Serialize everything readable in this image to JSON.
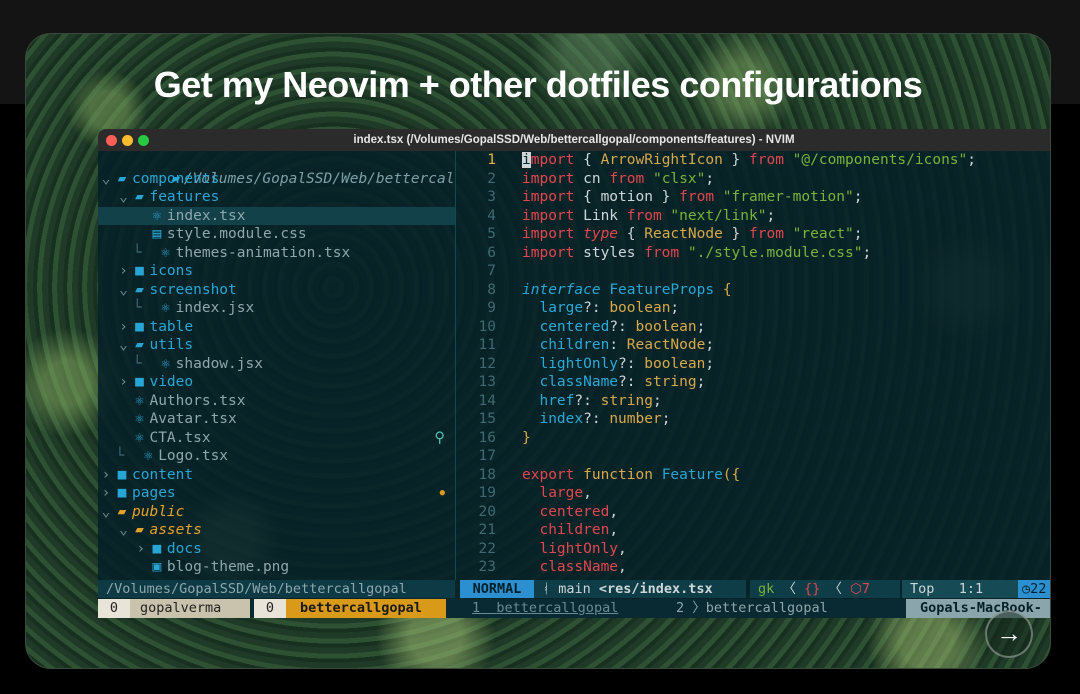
{
  "colors": {
    "accent_red": "#e0464e",
    "accent_green": "#79b33a",
    "accent_blue": "#27a6d6",
    "accent_yellow": "#d7a84a",
    "bg_terminal": "#062028"
  },
  "headline": "Get my Neovim + other dotfiles configurations",
  "window": {
    "title": "index.tsx (/Volumes/GopalSSD/Web/bettercallgopal/components/features) - NVIM"
  },
  "tree": {
    "root": "/Volumes/GopalSSD/Web/bettercallgopal",
    "items": [
      {
        "indent": "",
        "arrow": "⌄",
        "icon": "folder-open-icon",
        "label": "components",
        "color": "#27a6d6"
      },
      {
        "indent": "  ",
        "arrow": "⌄",
        "icon": "folder-open-icon",
        "label": "features",
        "color": "#27a6d6"
      },
      {
        "indent": "    ",
        "arrow": "",
        "icon": "react-icon",
        "label": "index.tsx",
        "color": "#8fa6ad",
        "selected": true
      },
      {
        "indent": "    ",
        "arrow": "",
        "icon": "css-icon",
        "label": "style.module.css",
        "color": "#8fa6ad"
      },
      {
        "indent": "    └",
        "arrow": "",
        "icon": "react-icon",
        "label": "themes-animation.tsx",
        "color": "#8fa6ad"
      },
      {
        "indent": "  ",
        "arrow": "›",
        "icon": "folder-icon",
        "label": "icons",
        "color": "#27a6d6"
      },
      {
        "indent": "  ",
        "arrow": "⌄",
        "icon": "folder-open-icon",
        "label": "screenshot",
        "color": "#27a6d6"
      },
      {
        "indent": "    └",
        "arrow": "",
        "icon": "react-icon",
        "label": "index.jsx",
        "color": "#8fa6ad"
      },
      {
        "indent": "  ",
        "arrow": "›",
        "icon": "folder-icon",
        "label": "table",
        "color": "#27a6d6"
      },
      {
        "indent": "  ",
        "arrow": "⌄",
        "icon": "folder-open-icon",
        "label": "utils",
        "color": "#27a6d6"
      },
      {
        "indent": "    └",
        "arrow": "",
        "icon": "react-icon",
        "label": "shadow.jsx",
        "color": "#8fa6ad"
      },
      {
        "indent": "  ",
        "arrow": "›",
        "icon": "folder-icon",
        "label": "video",
        "color": "#27a6d6"
      },
      {
        "indent": "  ",
        "arrow": "",
        "icon": "react-icon",
        "label": "Authors.tsx",
        "color": "#8fa6ad"
      },
      {
        "indent": "  ",
        "arrow": "",
        "icon": "react-icon",
        "label": "Avatar.tsx",
        "color": "#8fa6ad"
      },
      {
        "indent": "  ",
        "arrow": "",
        "icon": "react-icon",
        "label": "CTA.tsx",
        "color": "#8fa6ad",
        "badge": "bulb-icon"
      },
      {
        "indent": "  └",
        "arrow": "",
        "icon": "react-icon",
        "label": "Logo.tsx",
        "color": "#8fa6ad"
      },
      {
        "indent": "",
        "arrow": "›",
        "icon": "folder-icon",
        "label": "content",
        "color": "#27a6d6"
      },
      {
        "indent": "",
        "arrow": "›",
        "icon": "folder-icon",
        "label": "pages",
        "color": "#27a6d6",
        "badge": "modified-dot"
      },
      {
        "indent": "",
        "arrow": "⌄",
        "icon": "folder-open-icon",
        "label": "public",
        "color": "#e5a12b",
        "italic": true
      },
      {
        "indent": "  ",
        "arrow": "⌄",
        "icon": "folder-open-icon",
        "label": "assets",
        "color": "#e5a12b",
        "italic": true
      },
      {
        "indent": "    ",
        "arrow": "›",
        "icon": "folder-icon",
        "label": "docs",
        "color": "#27a6d6"
      },
      {
        "indent": "    ",
        "arrow": "",
        "icon": "image-icon",
        "label": "blog-theme.png",
        "color": "#8fa6ad"
      }
    ]
  },
  "editor": {
    "lines": [
      {
        "n": "1",
        "cur": true,
        "t": [
          [
            "cursor",
            "i"
          ],
          [
            "kw",
            "mport "
          ],
          [
            "pl",
            "{ "
          ],
          [
            "ty",
            "ArrowRightIcon"
          ],
          [
            "pl",
            " } "
          ],
          [
            "kw",
            "from "
          ],
          [
            "str",
            "\"@/components/icons\""
          ],
          [
            "pl",
            ";"
          ]
        ]
      },
      {
        "n": "2",
        "t": [
          [
            "kw",
            "import "
          ],
          [
            "pl",
            "cn "
          ],
          [
            "kw",
            "from "
          ],
          [
            "str",
            "\"clsx\""
          ],
          [
            "pl",
            ";"
          ]
        ]
      },
      {
        "n": "3",
        "t": [
          [
            "kw",
            "import "
          ],
          [
            "pl",
            "{ motion } "
          ],
          [
            "kw",
            "from "
          ],
          [
            "str",
            "\"framer-motion\""
          ],
          [
            "pl",
            ";"
          ]
        ]
      },
      {
        "n": "4",
        "t": [
          [
            "kw",
            "import "
          ],
          [
            "pl",
            "Link "
          ],
          [
            "kw",
            "from "
          ],
          [
            "str",
            "\"next/link\""
          ],
          [
            "pl",
            ";"
          ]
        ]
      },
      {
        "n": "5",
        "t": [
          [
            "kw",
            "import "
          ],
          [
            "kwi",
            "type "
          ],
          [
            "pl",
            "{ "
          ],
          [
            "ty",
            "ReactNode"
          ],
          [
            "pl",
            " } "
          ],
          [
            "kw",
            "from "
          ],
          [
            "str",
            "\"react\""
          ],
          [
            "pl",
            ";"
          ]
        ]
      },
      {
        "n": "6",
        "t": [
          [
            "kw",
            "import "
          ],
          [
            "pl",
            "styles "
          ],
          [
            "kw",
            "from "
          ],
          [
            "str",
            "\"./style.module.css\""
          ],
          [
            "pl",
            ";"
          ]
        ]
      },
      {
        "n": "7",
        "t": []
      },
      {
        "n": "8",
        "t": [
          [
            "tyi",
            "interface "
          ],
          [
            "fn",
            "FeatureProps "
          ],
          [
            "br",
            "{"
          ]
        ]
      },
      {
        "n": "9",
        "t": [
          [
            "pr",
            "  large"
          ],
          [
            "pl",
            "?: "
          ],
          [
            "ty",
            "boolean"
          ],
          [
            "pl",
            ";"
          ]
        ]
      },
      {
        "n": "10",
        "t": [
          [
            "pr",
            "  centered"
          ],
          [
            "pl",
            "?: "
          ],
          [
            "ty",
            "boolean"
          ],
          [
            "pl",
            ";"
          ]
        ]
      },
      {
        "n": "11",
        "t": [
          [
            "pr",
            "  children"
          ],
          [
            "pl",
            ": "
          ],
          [
            "ty",
            "ReactNode"
          ],
          [
            "pl",
            ";"
          ]
        ]
      },
      {
        "n": "12",
        "t": [
          [
            "pr",
            "  lightOnly"
          ],
          [
            "pl",
            "?: "
          ],
          [
            "ty",
            "boolean"
          ],
          [
            "pl",
            ";"
          ]
        ]
      },
      {
        "n": "13",
        "t": [
          [
            "pr",
            "  className"
          ],
          [
            "pl",
            "?: "
          ],
          [
            "ty",
            "string"
          ],
          [
            "pl",
            ";"
          ]
        ]
      },
      {
        "n": "14",
        "t": [
          [
            "pr",
            "  href"
          ],
          [
            "pl",
            "?: "
          ],
          [
            "ty",
            "string"
          ],
          [
            "pl",
            ";"
          ]
        ]
      },
      {
        "n": "15",
        "t": [
          [
            "pr",
            "  index"
          ],
          [
            "pl",
            "?: "
          ],
          [
            "ty",
            "number"
          ],
          [
            "pl",
            ";"
          ]
        ]
      },
      {
        "n": "16",
        "t": [
          [
            "br",
            "}"
          ]
        ]
      },
      {
        "n": "17",
        "t": []
      },
      {
        "n": "18",
        "t": [
          [
            "kw",
            "export "
          ],
          [
            "ty",
            "function "
          ],
          [
            "fn",
            "Feature"
          ],
          [
            "br",
            "({"
          ]
        ]
      },
      {
        "n": "19",
        "t": [
          [
            "kw",
            "  large"
          ],
          [
            "pl",
            ","
          ]
        ]
      },
      {
        "n": "20",
        "t": [
          [
            "kw",
            "  centered"
          ],
          [
            "pl",
            ","
          ]
        ]
      },
      {
        "n": "21",
        "t": [
          [
            "kw",
            "  children"
          ],
          [
            "pl",
            ","
          ]
        ]
      },
      {
        "n": "22",
        "t": [
          [
            "kw",
            "  lightOnly"
          ],
          [
            "pl",
            ","
          ]
        ]
      },
      {
        "n": "23",
        "t": [
          [
            "kw",
            "  className"
          ],
          [
            "pl",
            ","
          ]
        ]
      }
    ]
  },
  "statusline": {
    "tree_path": "/Volumes/GopalSSD/Web/bettercallgopal",
    "mode": "NORMAL",
    "branch": "main",
    "file": "<res/index.tsx",
    "gk": "gk",
    "braces": "{}",
    "errors": "7",
    "pos": "Top",
    "linecol": "1:1",
    "clock": "22"
  },
  "tmux": {
    "session_a_num": "0",
    "session_a": "gopalverma",
    "session_b_num": "0",
    "session_b": "bettercallgopal",
    "win1_num": "1",
    "win1": "bettercallgopal",
    "win2_num": "2",
    "win2": "bettercallgopal",
    "host": "Gopals-MacBook-"
  },
  "nav": {
    "next_arrow": "→"
  }
}
